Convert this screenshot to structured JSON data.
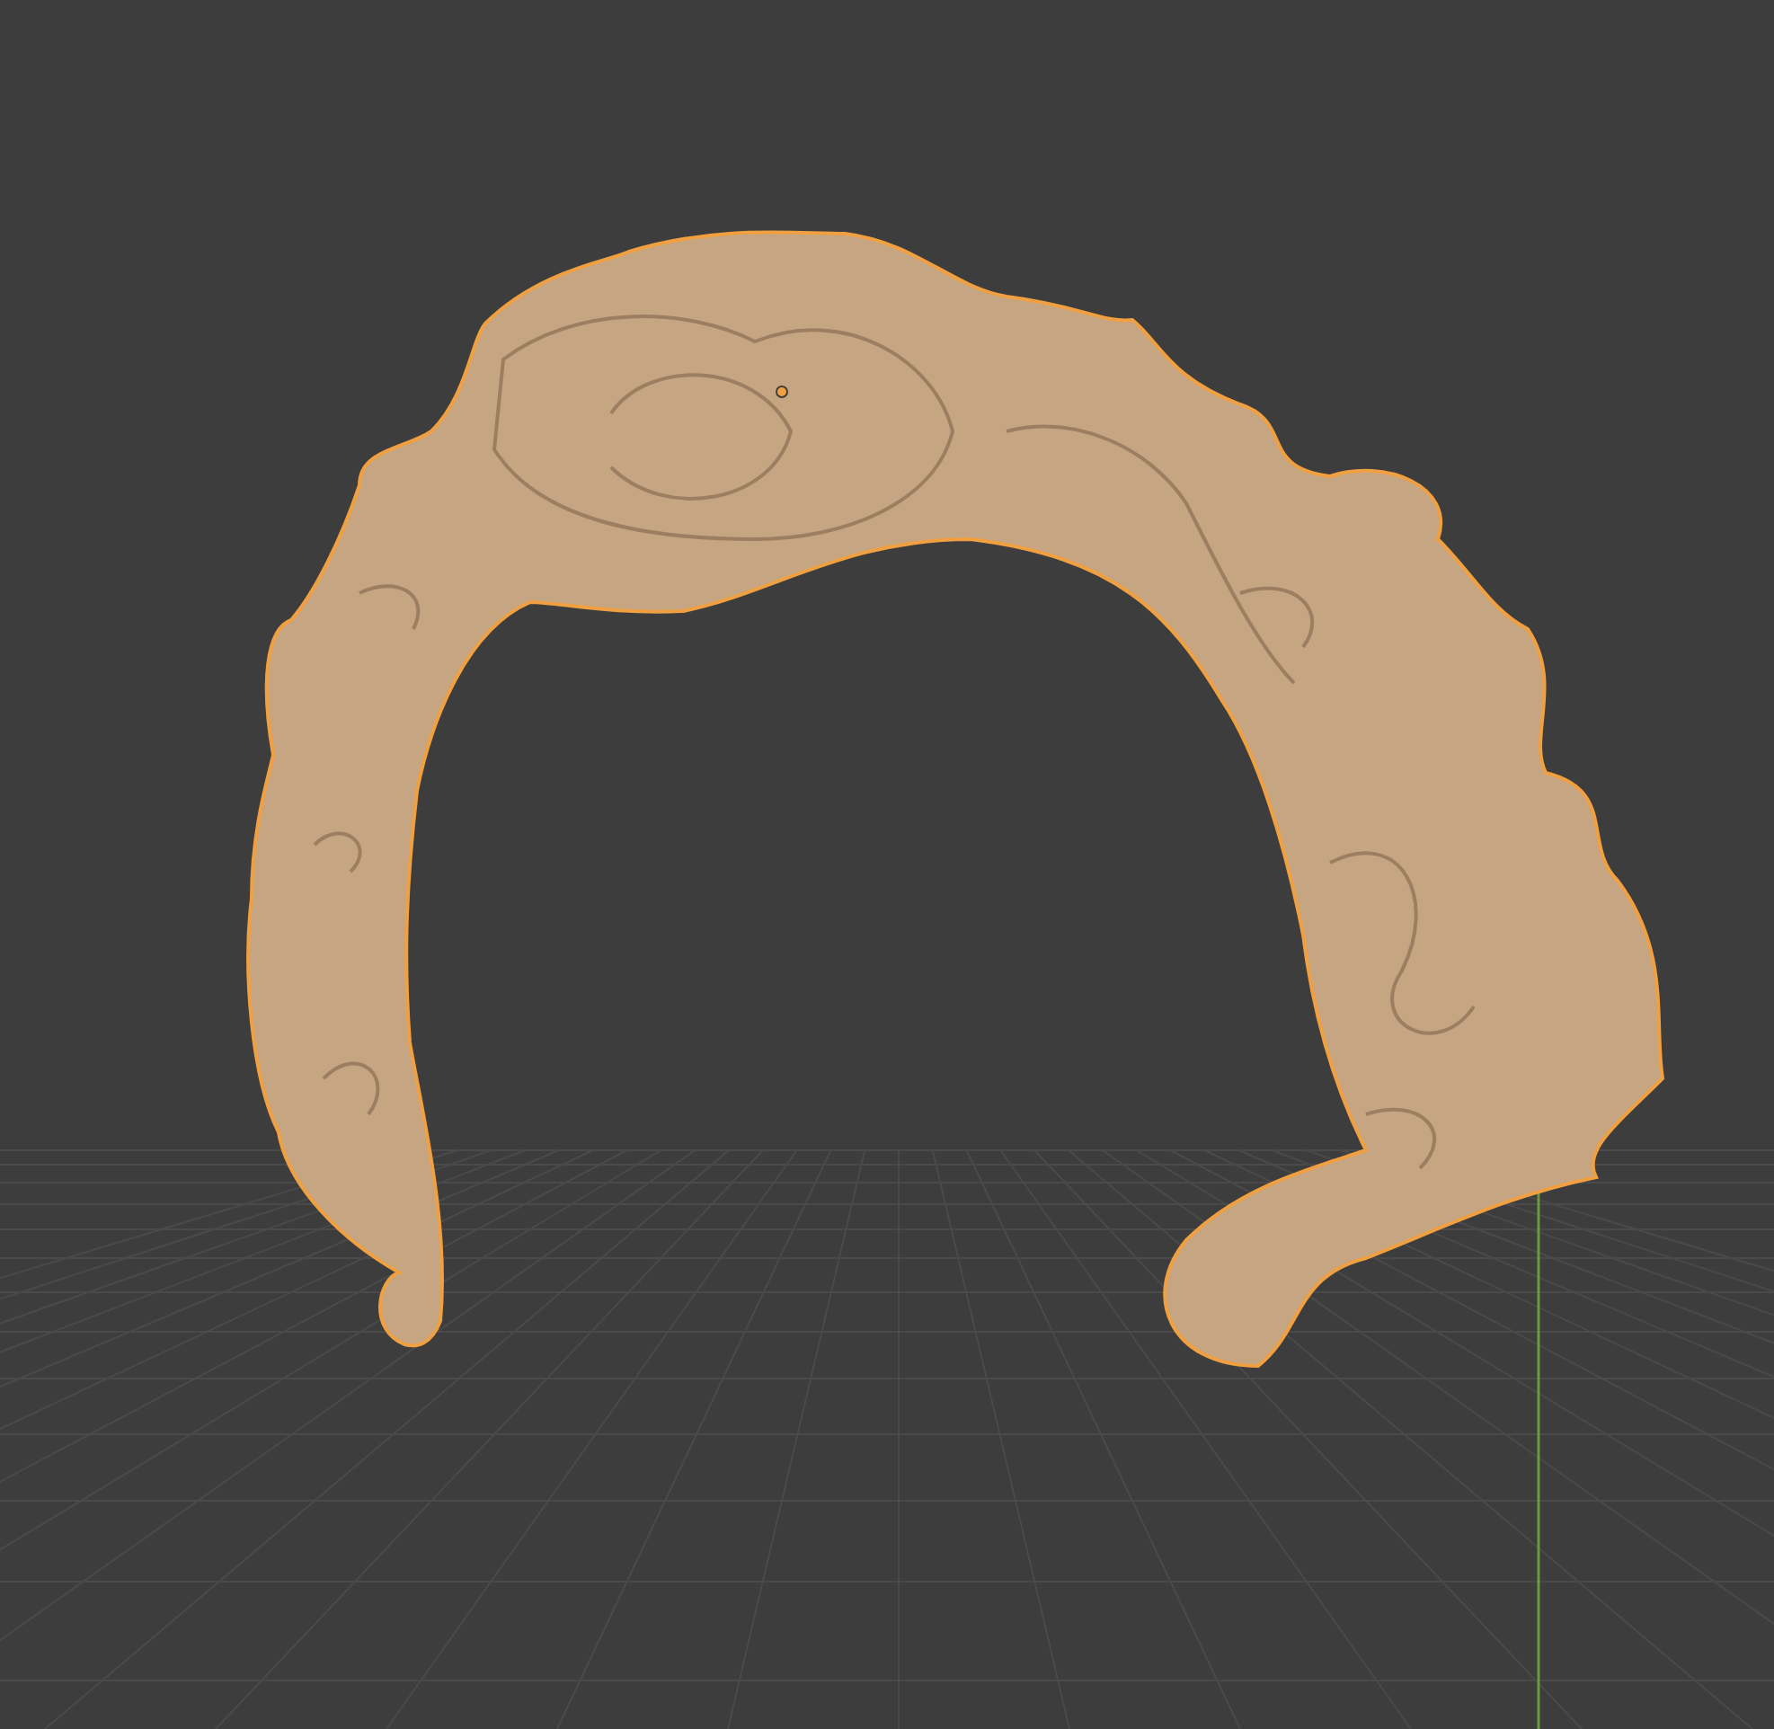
{
  "viewport": {
    "object": {
      "selected": true
    }
  }
}
